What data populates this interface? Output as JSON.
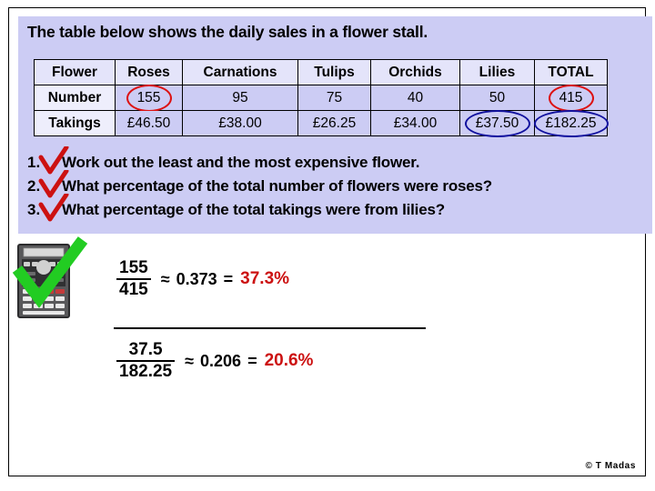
{
  "title": "The table below shows the daily sales in a flower stall.",
  "table": {
    "headers": [
      "Flower",
      "Roses",
      "Carnations",
      "Tulips",
      "Orchids",
      "Lilies",
      "TOTAL"
    ],
    "rows": [
      {
        "label": "Number",
        "values": [
          "155",
          "95",
          "75",
          "40",
          "50",
          "415"
        ]
      },
      {
        "label": "Takings",
        "values": [
          "£46.50",
          "£38.00",
          "£26.25",
          "£34.00",
          "£37.50",
          "£182.25"
        ]
      }
    ]
  },
  "annotations": {
    "red_circle_color": "#dd1111",
    "blue_circle_color": "#11119e",
    "tick_red_color": "#cc1111",
    "tick_green_color": "#22cc22"
  },
  "questions": [
    {
      "number": "1.",
      "text": "Work out the least and the most expensive flower."
    },
    {
      "number": "2.",
      "text": "What percentage of the total number of flowers were roses?"
    },
    {
      "number": "3.",
      "text": "What percentage of the total takings were from lilies?"
    }
  ],
  "working": [
    {
      "numerator": "155",
      "denominator": "415",
      "approx": "≈",
      "decimal": "0.373",
      "equals": "=",
      "percent": "37.3%"
    },
    {
      "numerator": "37.5",
      "denominator": "182.25",
      "approx": "≈",
      "decimal": "0.206",
      "equals": "=",
      "percent": "20.6%"
    }
  ],
  "icons": {
    "calculator": "calculator-icon",
    "green_check": "green-check-icon",
    "red_check": "red-check-icon"
  },
  "footer": {
    "credit": "© T Madas"
  }
}
